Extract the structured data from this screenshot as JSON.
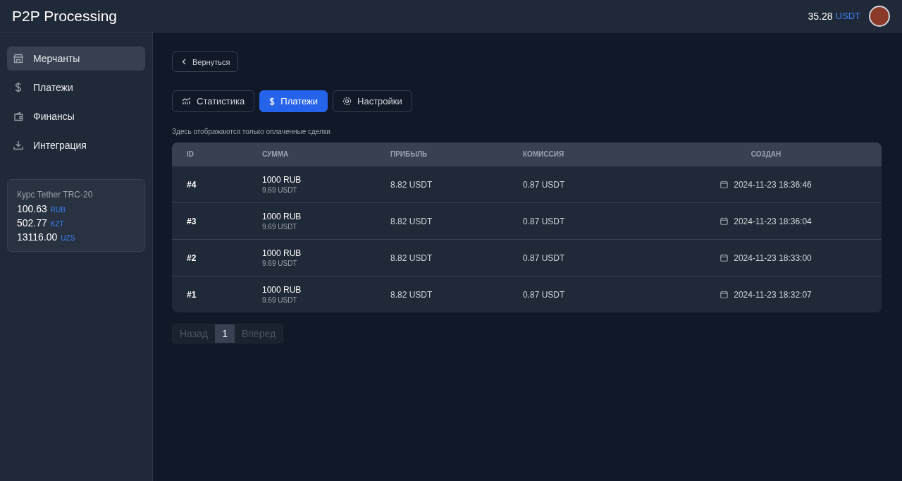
{
  "header": {
    "title": "P2P Processing",
    "balance": "35.28",
    "currency": "USDT"
  },
  "sidebar": {
    "items": [
      {
        "label": "Мерчанты",
        "selected": true
      },
      {
        "label": "Платежи",
        "selected": false
      },
      {
        "label": "Финансы",
        "selected": false
      },
      {
        "label": "Интеграция",
        "selected": false
      }
    ],
    "rates": {
      "title": "Курс Tether TRC-20",
      "items": [
        {
          "value": "100.63",
          "currency": "RUB"
        },
        {
          "value": "502.77",
          "currency": "KZT"
        },
        {
          "value": "13116.00",
          "currency": "UZS"
        }
      ]
    }
  },
  "back_button": "Вернуться",
  "tabs": [
    {
      "label": "Статистика",
      "selected": false
    },
    {
      "label": "Платежи",
      "selected": true
    },
    {
      "label": "Настройки",
      "selected": false
    }
  ],
  "note": "Здесь отображаются только оплаченные сделки",
  "table": {
    "columns": [
      "ID",
      "СУММА",
      "ПРИБЫЛЬ",
      "КОМИССИЯ",
      "СОЗДАН"
    ],
    "rows": [
      {
        "id": "#4",
        "amount": "1000 RUB",
        "amount_usdt": "9.69 USDT",
        "profit": "8.82 USDT",
        "fee": "0.87 USDT",
        "created": "2024-11-23 18:36:46"
      },
      {
        "id": "#3",
        "amount": "1000 RUB",
        "amount_usdt": "9.69 USDT",
        "profit": "8.82 USDT",
        "fee": "0.87 USDT",
        "created": "2024-11-23 18:36:04"
      },
      {
        "id": "#2",
        "amount": "1000 RUB",
        "amount_usdt": "9.69 USDT",
        "profit": "8.82 USDT",
        "fee": "0.87 USDT",
        "created": "2024-11-23 18:33:00"
      },
      {
        "id": "#1",
        "amount": "1000 RUB",
        "amount_usdt": "9.69 USDT",
        "profit": "8.82 USDT",
        "fee": "0.87 USDT",
        "created": "2024-11-23 18:32:07"
      }
    ]
  },
  "pagination": {
    "prev": {
      "label": "Назад",
      "disabled": true
    },
    "pages": [
      {
        "label": "1",
        "selected": true
      }
    ],
    "next": {
      "label": "Вперед",
      "disabled": true
    }
  }
}
